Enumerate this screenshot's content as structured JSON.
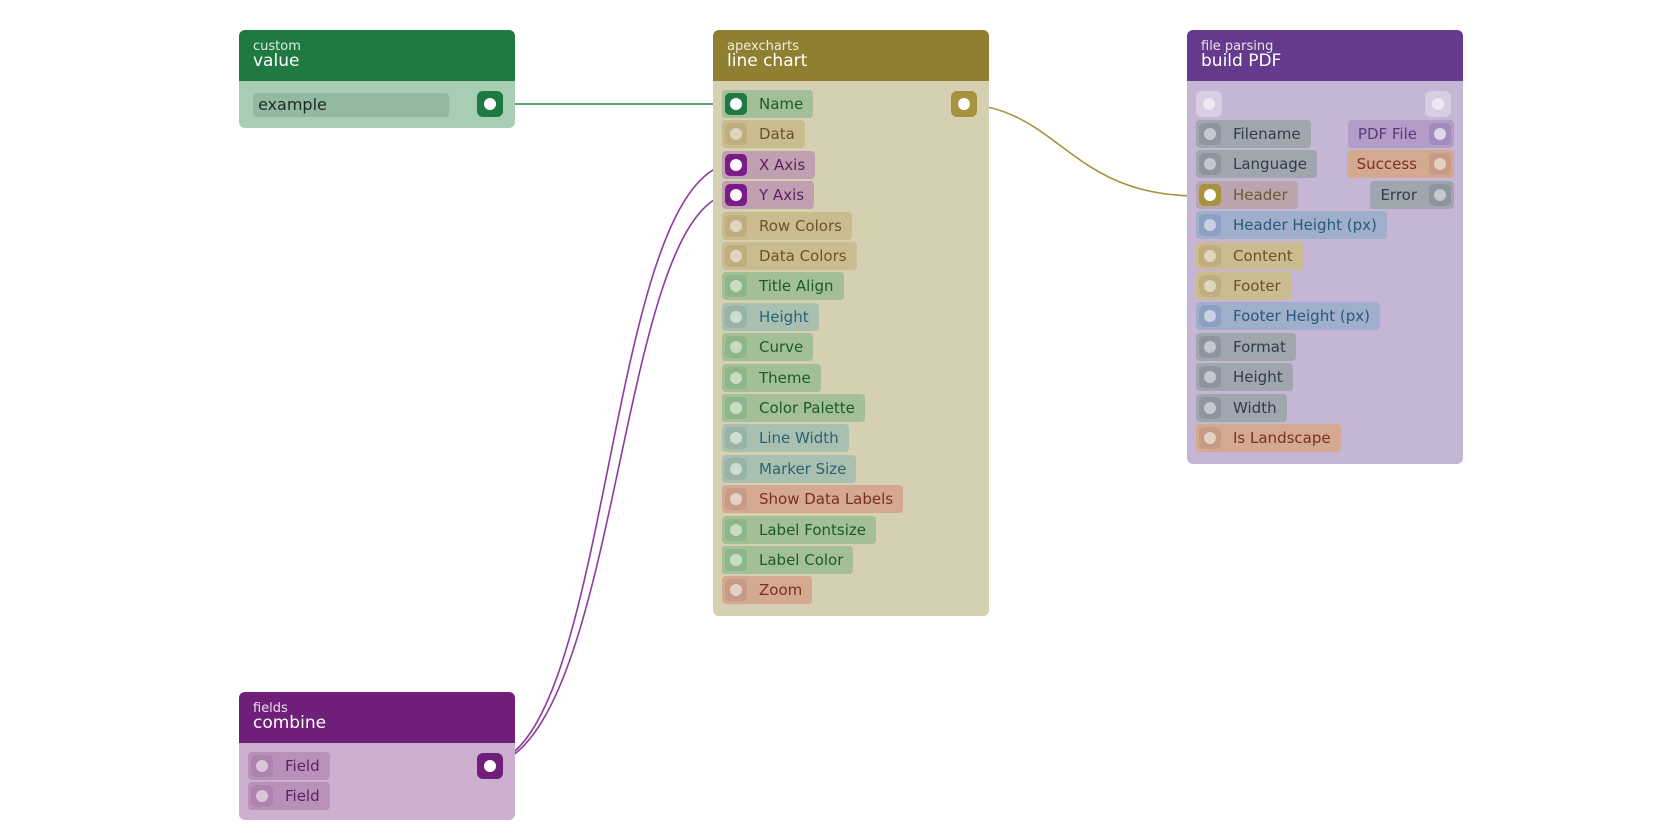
{
  "colors": {
    "wire_green": "#2f7d48",
    "wire_purple": "#8e3a9e",
    "wire_gold": "#a8923d"
  },
  "nodes": {
    "custom_value": {
      "category": "custom",
      "title": "value",
      "header_color": "#1e7a40",
      "body_color": "#a7cdb3",
      "input_value": "example"
    },
    "line_chart": {
      "category": "apexcharts",
      "title": "line chart",
      "header_color": "#8e8030",
      "body_color": "#d5d0b2",
      "inputs": [
        {
          "label": "Name",
          "kind": "green",
          "connected": true
        },
        {
          "label": "Data",
          "kind": "tan"
        },
        {
          "label": "X Axis",
          "kind": "purple",
          "connected": true
        },
        {
          "label": "Y Axis",
          "kind": "purple",
          "connected": true
        },
        {
          "label": "Row Colors",
          "kind": "tan"
        },
        {
          "label": "Data Colors",
          "kind": "tan"
        },
        {
          "label": "Title Align",
          "kind": "green"
        },
        {
          "label": "Height",
          "kind": "teal"
        },
        {
          "label": "Curve",
          "kind": "green"
        },
        {
          "label": "Theme",
          "kind": "green"
        },
        {
          "label": "Color Palette",
          "kind": "green"
        },
        {
          "label": "Line Width",
          "kind": "teal"
        },
        {
          "label": "Marker Size",
          "kind": "teal"
        },
        {
          "label": "Show Data Labels",
          "kind": "red"
        },
        {
          "label": "Label Fontsize",
          "kind": "green"
        },
        {
          "label": "Label Color",
          "kind": "green"
        },
        {
          "label": "Zoom",
          "kind": "red"
        }
      ]
    },
    "build_pdf": {
      "category": "file parsing",
      "title": "build PDF",
      "header_color": "#653a8c",
      "body_color": "#c6b6d6",
      "inputs": [
        {
          "label": "Filename",
          "kind": "gray"
        },
        {
          "label": "Language",
          "kind": "gray"
        },
        {
          "label": "Header",
          "kind": "gold",
          "connected": true
        },
        {
          "label": "Header Height (px)",
          "kind": "blue"
        },
        {
          "label": "Content",
          "kind": "tan"
        },
        {
          "label": "Footer",
          "kind": "tan"
        },
        {
          "label": "Footer Height (px)",
          "kind": "blue"
        },
        {
          "label": "Format",
          "kind": "gray"
        },
        {
          "label": "Height",
          "kind": "gray"
        },
        {
          "label": "Width",
          "kind": "gray"
        },
        {
          "label": "Is Landscape",
          "kind": "red"
        }
      ],
      "outputs": [
        {
          "label": "PDF File",
          "kind": "violet"
        },
        {
          "label": "Success",
          "kind": "red"
        },
        {
          "label": "Error",
          "kind": "gray"
        }
      ]
    },
    "combine": {
      "category": "fields",
      "title": "combine",
      "header_color": "#6f1f79",
      "body_color": "#cdb0cf",
      "inputs": [
        {
          "label": "Field",
          "kind": "purple_light"
        },
        {
          "label": "Field",
          "kind": "purple_light"
        }
      ]
    }
  }
}
